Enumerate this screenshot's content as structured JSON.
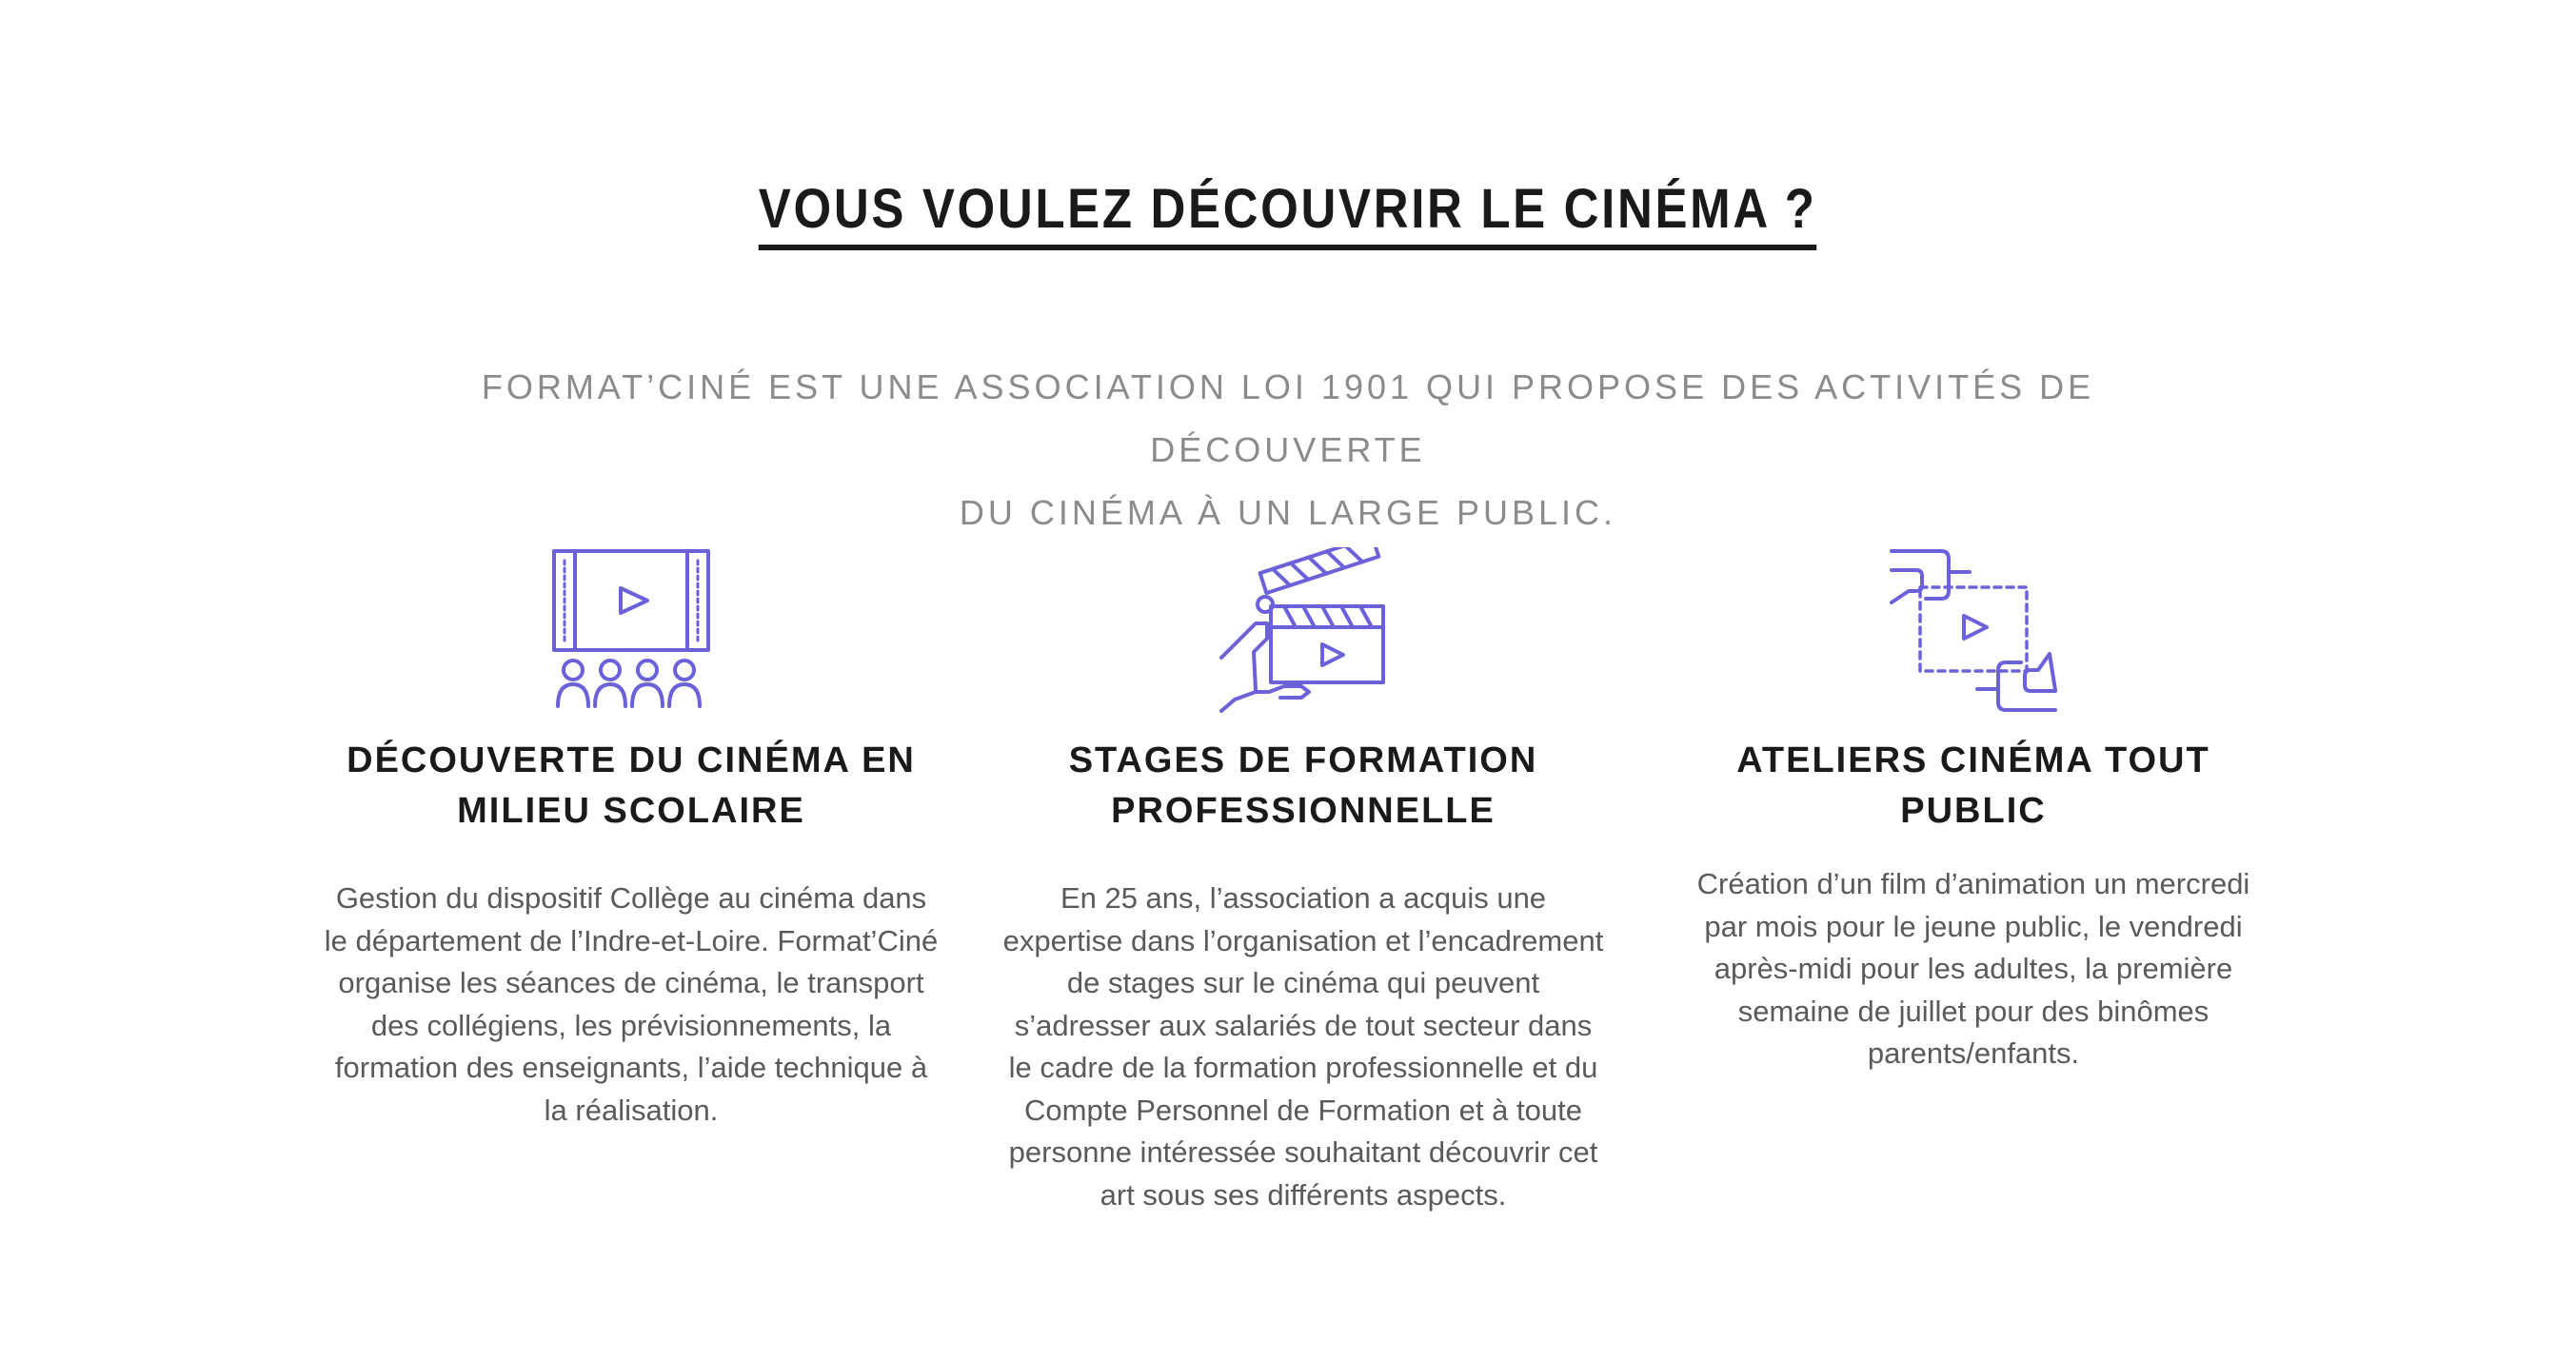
{
  "heading": {
    "title": "VOUS VOULEZ DÉCOUVRIR LE CINÉMA ?"
  },
  "intro": {
    "line1": "FORMAT’CINÉ EST UNE ASSOCIATION LOI 1901 QUI PROPOSE DES ACTIVITÉS DE DÉCOUVERTE",
    "line2": "DU CINÉMA À UN LARGE PUBLIC."
  },
  "colors": {
    "accent": "#6b62d9",
    "title": "#1a1a1a",
    "subtitle": "#8b8b8b",
    "body": "#5a5a5a"
  },
  "features": [
    {
      "icon": "film-screen-audience-icon",
      "title_line1": "DÉCOUVERTE DU CINÉMA EN",
      "title_line2": "MILIEU SCOLAIRE",
      "description": "Gestion du dispositif Collège au cinéma dans le département de l’Indre-et-Loire. Format’Ciné organise les séances de cinéma, le transport des collégiens, les prévisionnements, la formation des enseignants, l’aide technique à la réalisation."
    },
    {
      "icon": "clapperboard-hand-icon",
      "title_line1": "STAGES DE FORMATION",
      "title_line2": "PROFESSIONNELLE",
      "description": "En 25 ans, l’association a acquis une expertise dans l’organisation et l’encadrement de stages sur le cinéma qui peuvent s’adresser aux salariés de tout secteur dans le cadre de la formation professionnelle et du Compte Personnel de Formation et à toute personne intéressée souhaitant découvrir cet art sous ses différents aspects."
    },
    {
      "icon": "hands-frame-icon",
      "title_line1": "ATELIERS CINÉMA TOUT PUBLIC",
      "title_line2": "",
      "description": "Création d’un film d’animation un mercredi par mois pour le jeune public, le vendredi après-midi pour les adultes, la première semaine de juillet pour des binômes parents/enfants."
    }
  ]
}
